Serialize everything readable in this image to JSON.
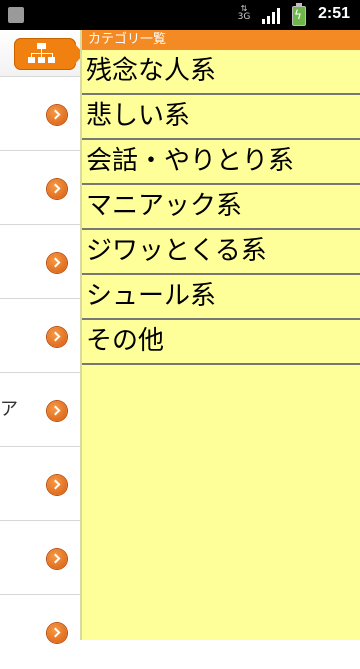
{
  "status_bar": {
    "network": "3G",
    "time": "2:51"
  },
  "panel": {
    "title": "カテゴリ一覧",
    "categories": [
      "残念な人系",
      "悲しい系",
      "会話・やりとり系",
      "マニアック系",
      "ジワッとくる系",
      "シュール系",
      "その他"
    ]
  },
  "background_list": {
    "partial_text_row5": "ア"
  },
  "colors": {
    "accent_orange": "#f08010",
    "panel_yellow": "#ffff99",
    "title_bar": "#f48a24"
  },
  "icons": [
    "home-icon",
    "chevron-right-icon",
    "signal-icon",
    "battery-icon"
  ]
}
